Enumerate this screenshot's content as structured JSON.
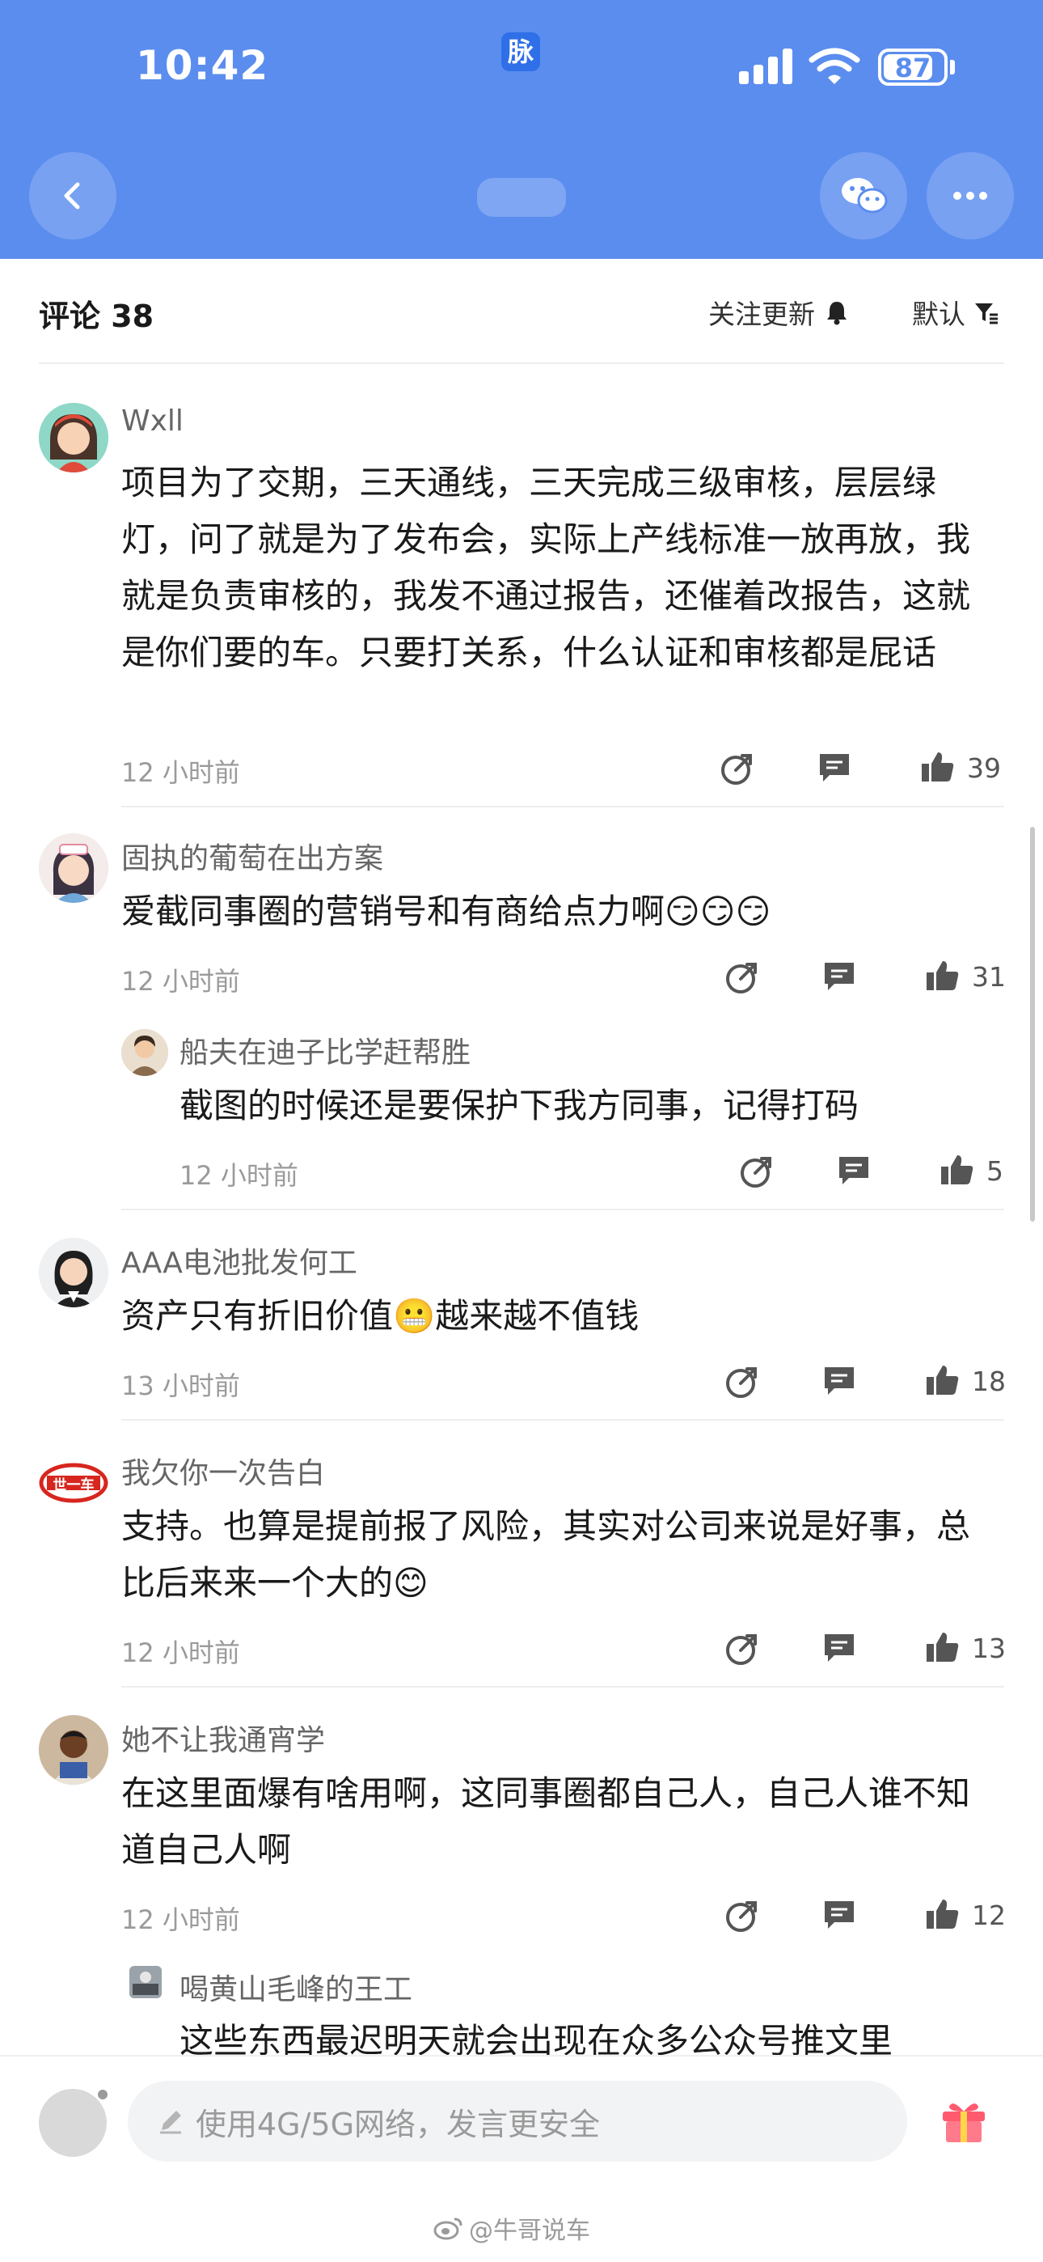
{
  "status_bar": {
    "time": "10:42",
    "app_badge": "脉",
    "battery": "87"
  },
  "section": {
    "title": "评论 38",
    "follow_label": "关注更新",
    "sort_label": "默认"
  },
  "comments": [
    {
      "user": "Wxll",
      "text": "项目为了交期，三天通线，三天完成三级审核，层层绿灯，问了就是为了发布会，实际上产线标准一放再放，我就是负责审核的，我发不通过报告，还催着改报告，这就是你们要的车。只要打关系，什么认证和审核都是屁话",
      "time": "12 小时前",
      "likes": "39"
    },
    {
      "user": "固执的葡萄在出方案",
      "text": "爱截同事圈的营销号和有商给点力啊😏😏😏",
      "time": "12 小时前",
      "likes": "31"
    },
    {
      "user": "船夫在迪子比学赶帮胜",
      "text": "截图的时候还是要保护下我方同事，记得打码",
      "time": "12 小时前",
      "likes": "5",
      "reply": true
    },
    {
      "user": "AAA电池批发何工",
      "text": "资产只有折旧价值😬越来越不值钱",
      "time": "13 小时前",
      "likes": "18"
    },
    {
      "user": "我欠你一次告白",
      "text": "支持。也算是提前报了风险，其实对公司来说是好事，总比后来来一个大的😊",
      "time": "12 小时前",
      "likes": "13",
      "avatar_text": "世一车"
    },
    {
      "user": "她不让我通宵学",
      "text": "在这里面爆有啥用啊，这同事圈都自己人，自己人谁不知道自己人啊",
      "time": "12 小时前",
      "likes": "12"
    },
    {
      "user": "喝黄山毛峰的王工",
      "text": "这些东西最迟明天就会出现在众多公众号推文里",
      "reply": true
    }
  ],
  "input": {
    "placeholder": "使用4G/5G网络，发言更安全"
  },
  "watermark": "@牛哥说车",
  "colors": {
    "header": "#5b8def",
    "text": "#1a1a1a",
    "muted": "#9a9a9a"
  }
}
